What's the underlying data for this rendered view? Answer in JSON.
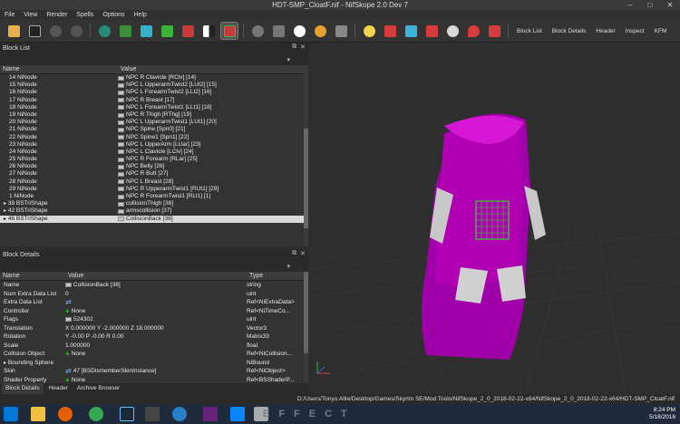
{
  "window": {
    "title": "HDT-SMP_CloatF.nif - NifSkope 2.0 Dev 7",
    "controls": [
      "–",
      "□",
      "✕"
    ]
  },
  "menu": [
    "File",
    "View",
    "Render",
    "Spells",
    "Options",
    "Help"
  ],
  "toolbar": {
    "text_buttons": [
      "Block List",
      "Block Details",
      "Header",
      "Inspect",
      "KFM"
    ]
  },
  "block_list": {
    "title": "Block List",
    "columns": [
      "Name",
      "Value"
    ],
    "rows": [
      {
        "name": "14 NiNode",
        "value": "NPC R Clavicle [RClv] [14]"
      },
      {
        "name": "15 NiNode",
        "value": "NPC L UpperarmTwist2 [LUt2] [15]"
      },
      {
        "name": "16 NiNode",
        "value": "NPC L ForearmTwist2 [LLt2] [16]"
      },
      {
        "name": "17 NiNode",
        "value": "NPC R Breast [17]"
      },
      {
        "name": "18 NiNode",
        "value": "NPC L ForearmTwist1 [LLt1] [18]"
      },
      {
        "name": "19 NiNode",
        "value": "NPC R Thigh [RThg] [19]"
      },
      {
        "name": "20 NiNode",
        "value": "NPC L UpperarmTwist1 [LUt1] [20]"
      },
      {
        "name": "21 NiNode",
        "value": "NPC Spine [Spn0] [21]"
      },
      {
        "name": "22 NiNode",
        "value": "NPC Spine1 [Spn1] [22]"
      },
      {
        "name": "23 NiNode",
        "value": "NPC L UpperArm [LUar] [23]"
      },
      {
        "name": "24 NiNode",
        "value": "NPC L Clavicle [LClv] [24]"
      },
      {
        "name": "25 NiNode",
        "value": "NPC R Forearm [RLar] [25]"
      },
      {
        "name": "26 NiNode",
        "value": "NPC Belly [26]"
      },
      {
        "name": "27 NiNode",
        "value": "NPC R Butt [27]"
      },
      {
        "name": "28 NiNode",
        "value": "NPC L Breast [28]"
      },
      {
        "name": "29 NiNode",
        "value": "NPC R UpperarmTwist1 [RUt1] [29]"
      },
      {
        "name": "1 NiNode",
        "value": "NPC R ForearmTwist1 [RLt1] [1]"
      },
      {
        "name": "38 BSTriShape",
        "value": "collisionThigh [36]"
      },
      {
        "name": "42 BSTriShape",
        "value": "armscollision [37]"
      },
      {
        "name": "46 BSTriShape",
        "value": "CollisionBack [38]"
      }
    ]
  },
  "block_details": {
    "title": "Block Details",
    "columns": [
      "Name",
      "Value",
      "Type"
    ],
    "rows": [
      {
        "name": "Name",
        "value": "CollisionBack [38]",
        "type": "string",
        "plus": false
      },
      {
        "name": "Num Extra Data List",
        "value": "0",
        "type": "uint",
        "plus": false
      },
      {
        "name": "Extra Data List",
        "value": "",
        "type": "Ref<NiExtraData>",
        "plus": false
      },
      {
        "name": "Controller",
        "value": "None",
        "type": "Ref<NiTimeCo...",
        "plus": true
      },
      {
        "name": "Flags",
        "value": "524302",
        "type": "uint",
        "plus": false
      },
      {
        "name": "Translation",
        "value": "X 0.000000 Y -2.000000 Z 18.000000",
        "type": "Vector3",
        "plus": false
      },
      {
        "name": "Rotation",
        "value": "Y -0.00 P -0.00 R 0.00",
        "type": "Matrix33",
        "plus": false
      },
      {
        "name": "Scale",
        "value": "1.000000",
        "type": "float",
        "plus": false
      },
      {
        "name": "Collision Object",
        "value": "None",
        "type": "Ref<NiCollision...",
        "plus": true
      },
      {
        "name": "Bounding Sphere",
        "value": "",
        "type": "NiBound",
        "plus": false
      },
      {
        "name": "Skin",
        "value": "47 [BSDismemberSkinInstance]",
        "type": "Ref<NiObject>",
        "plus": false
      },
      {
        "name": "Shader Property",
        "value": "None",
        "type": "Ref<BSShaderP...",
        "plus": true
      }
    ]
  },
  "bottom_tabs": [
    "Block Details",
    "Header",
    "Archive Browser"
  ],
  "status_path": "D:/Users/Tonyo Allie/Desktop/Games/Skyrim SE/Mod Tools/NifSkope_2_0_2018-02-22-x64/NifSkope_2_0_2018-02-22-x64/HDT-SMP_CloatF.nif",
  "taskbar": {
    "time": "8:24 PM",
    "date": "5/18/2018",
    "watermark": "EFFECT"
  },
  "colors": {
    "cape": "#b100b1",
    "cape_highlight": "#d618d6",
    "collision_mesh": "#2ad82a",
    "arm_gray": "#c8c8c8"
  }
}
